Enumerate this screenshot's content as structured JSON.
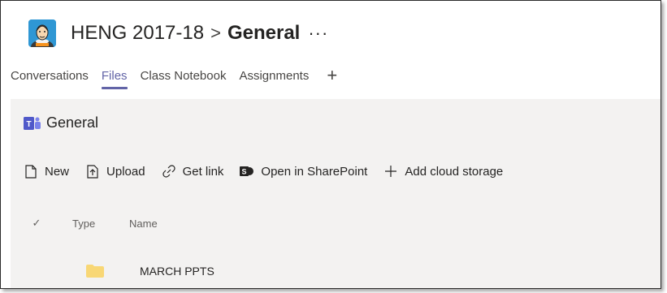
{
  "header": {
    "team_name": "HENG 2017-18",
    "separator": ">",
    "channel": "General",
    "more": "···"
  },
  "tabs": [
    {
      "label": "Conversations",
      "active": false
    },
    {
      "label": "Files",
      "active": true
    },
    {
      "label": "Class Notebook",
      "active": false
    },
    {
      "label": "Assignments",
      "active": false
    }
  ],
  "add_tab": "+",
  "breadcrumb": {
    "label": "General"
  },
  "toolbar": {
    "new_label": "New",
    "upload_label": "Upload",
    "get_link_label": "Get link",
    "sharepoint_label": "Open in SharePoint",
    "add_cloud_label": "Add cloud storage"
  },
  "columns": {
    "check": "✓",
    "type": "Type",
    "name": "Name"
  },
  "files": [
    {
      "name": "MARCH PPTS",
      "icon": "folder-icon"
    }
  ],
  "colors": {
    "accent": "#6264a7",
    "folder": "#f8d775",
    "content_bg": "#f3f2f1"
  }
}
